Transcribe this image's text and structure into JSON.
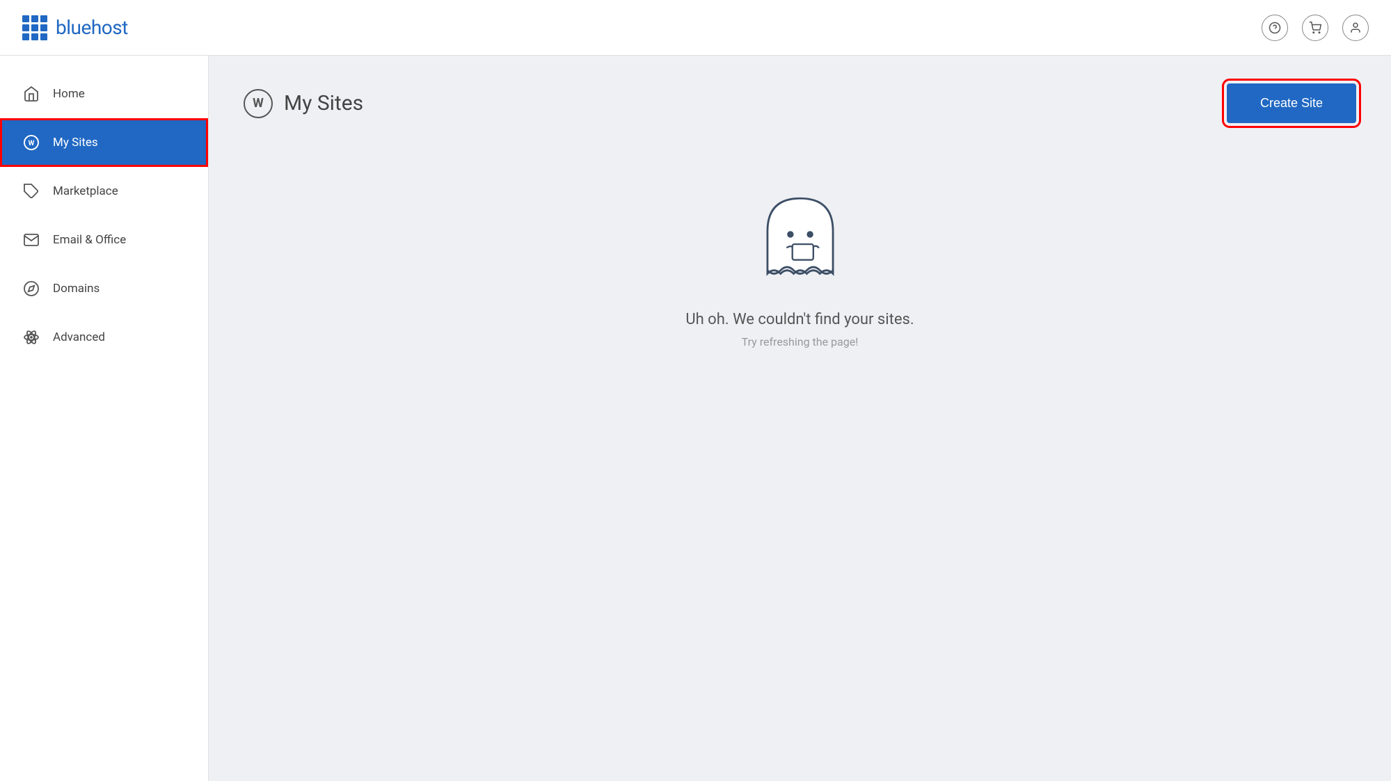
{
  "header": {
    "logo_text": "bluehost",
    "help_icon": "?",
    "cart_icon": "cart",
    "user_icon": "user"
  },
  "sidebar": {
    "items": [
      {
        "id": "home",
        "label": "Home",
        "icon": "home"
      },
      {
        "id": "my-sites",
        "label": "My Sites",
        "icon": "wordpress",
        "active": true
      },
      {
        "id": "marketplace",
        "label": "Marketplace",
        "icon": "tag"
      },
      {
        "id": "email-office",
        "label": "Email & Office",
        "icon": "mail"
      },
      {
        "id": "domains",
        "label": "Domains",
        "icon": "compass"
      },
      {
        "id": "advanced",
        "label": "Advanced",
        "icon": "atom"
      }
    ]
  },
  "main": {
    "page_title": "My Sites",
    "create_site_label": "Create Site",
    "empty_title": "Uh oh. We couldn't find your sites.",
    "empty_subtitle": "Try refreshing the page!"
  }
}
